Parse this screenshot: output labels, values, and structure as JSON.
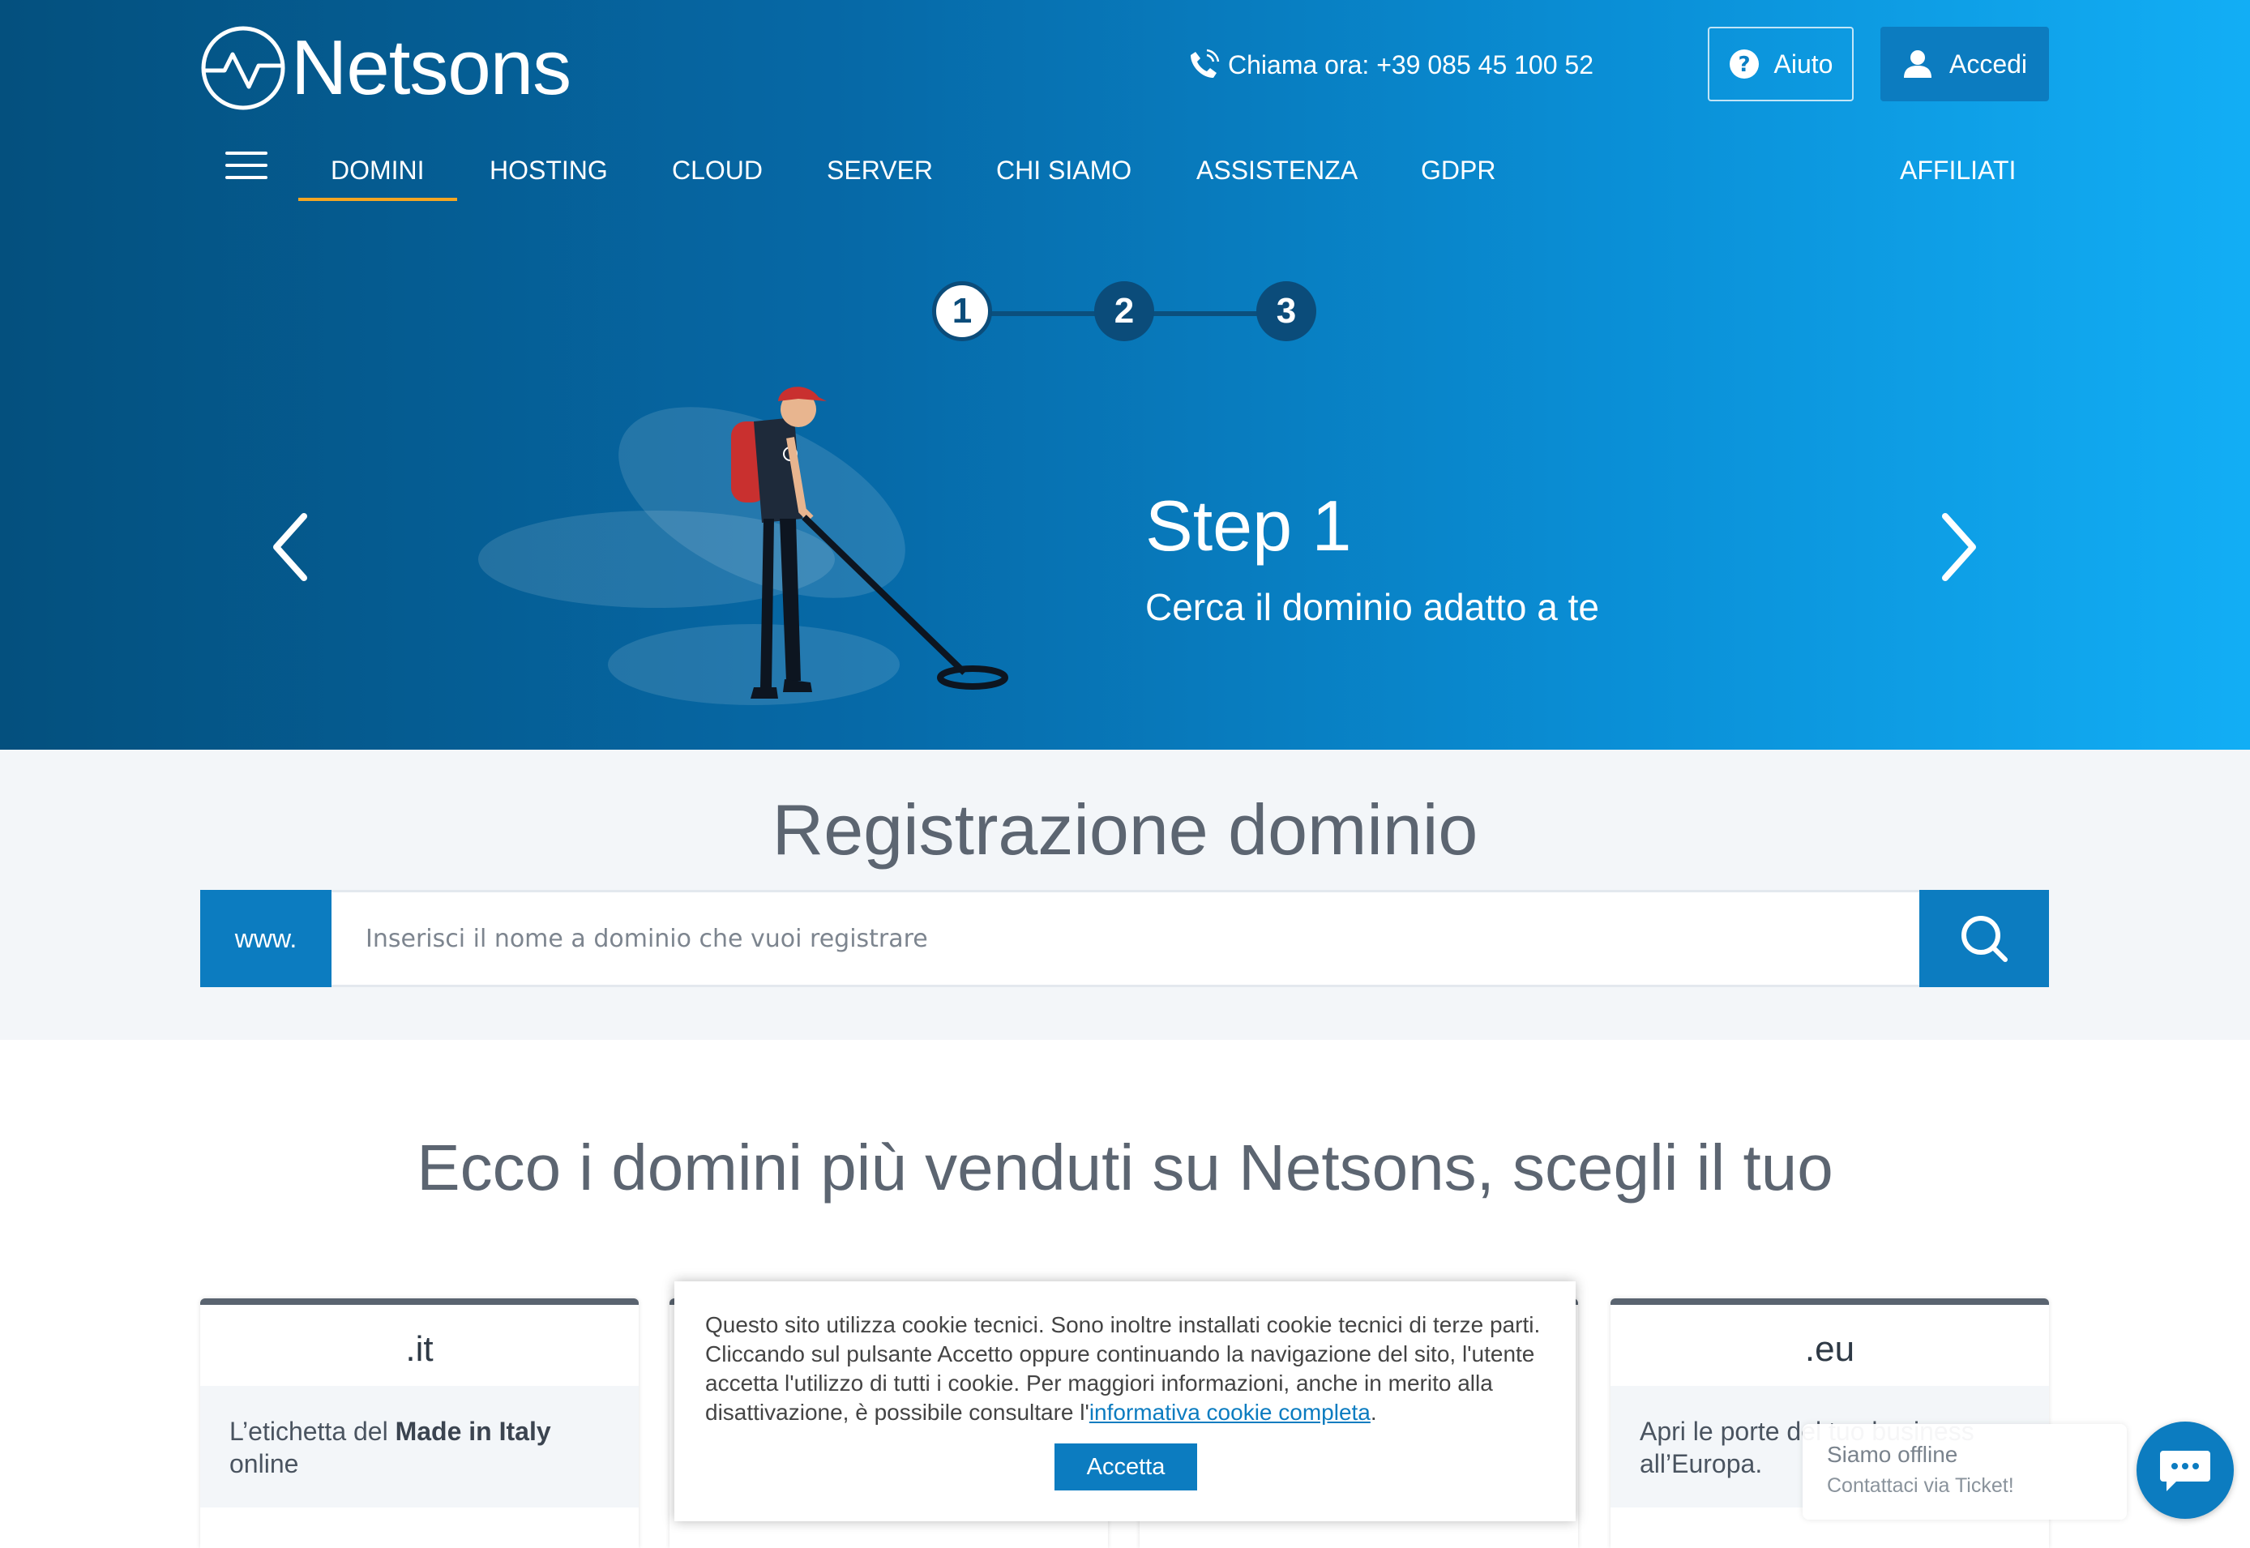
{
  "header": {
    "logo_text": "Netsons",
    "phone_text": "Chiama ora: +39 085 45 100 52",
    "help_label": "Aiuto",
    "login_label": "Accedi"
  },
  "nav": {
    "items": [
      "DOMINI",
      "HOSTING",
      "CLOUD",
      "SERVER",
      "CHI SIAMO",
      "ASSISTENZA",
      "GDPR"
    ],
    "right_item": "AFFILIATI",
    "active": "DOMINI"
  },
  "slider": {
    "steps": [
      "1",
      "2",
      "3"
    ],
    "active_step": "1",
    "title": "Step 1",
    "subtitle": "Cerca il dominio adatto a te"
  },
  "search": {
    "title": "Registrazione dominio",
    "prefix": "www.",
    "placeholder": "Inserisci il nome a dominio che vuoi registrare"
  },
  "domains": {
    "title": "Ecco i domini più venduti su Netsons, scegli il tuo",
    "cards": [
      {
        "ext": ".it",
        "desc_pre": "L’etichetta del ",
        "desc_bold": "Made in Italy",
        "desc_post": " online"
      },
      {
        "ext": ".eu",
        "desc": "Apri le porte del tuo business all’Europa."
      }
    ]
  },
  "cookie": {
    "text": "Questo sito utilizza cookie tecnici. Sono inoltre installati cookie tecnici di terze parti. Cliccando sul pulsante Accetto oppure continuando la navigazione del sito, l'utente accetta l'utilizzo di tutti i cookie. Per maggiori informazioni, anche in merito alla disattivazione, è possibile consultare l'",
    "link_text": "informativa cookie completa",
    "text_end": ".",
    "button_label": "Accetta"
  },
  "chat": {
    "status": "Siamo offline",
    "note": "Contattaci via Ticket!"
  },
  "colors": {
    "brand_blue": "#0c7cc0",
    "nav_active_underline": "#f4a623",
    "hero_dark": "#04507e",
    "hero_light": "#12aef5"
  }
}
